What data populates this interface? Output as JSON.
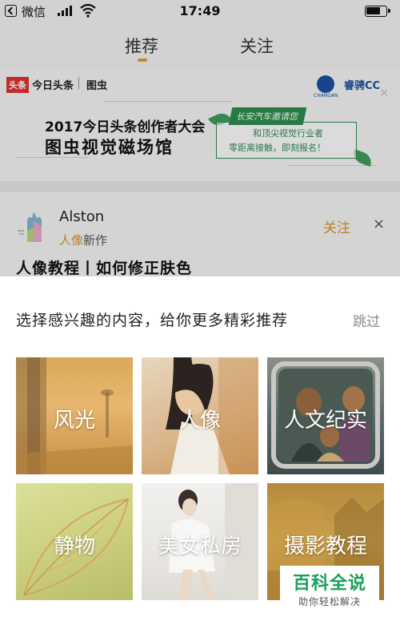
{
  "status_bar": {
    "carrier": "微信",
    "time": "17:49"
  },
  "tabs": [
    {
      "label": "推荐",
      "active": true
    },
    {
      "label": "关注",
      "active": false
    }
  ],
  "ad": {
    "logo_toutiao_badge": "头条",
    "logo_toutiao": "今日头条",
    "logo_tuchong": "图虫",
    "changan": "CHANGAN",
    "brand": "睿骋CC",
    "title_line1": "2017今日头条创作者大会",
    "title_line2": "图虫视觉磁场馆",
    "tag": "长安汽车邀请您",
    "line1": "和顶尖视觉行业者",
    "line2": "零距离接触，即刻报名！",
    "close": "×"
  },
  "card": {
    "author_name": "Alston",
    "author_tag_highlight": "人像",
    "author_tag_rest": "新作",
    "follow_label": "关注",
    "dismiss": "×",
    "title": "人像教程丨如何修正肤色"
  },
  "sheet": {
    "title": "选择感兴趣的内容，给你更多精彩推荐",
    "skip": "跳过",
    "tiles": [
      {
        "label": "风光"
      },
      {
        "label": "人像"
      },
      {
        "label": "人文纪实"
      },
      {
        "label": "静物"
      },
      {
        "label": "美女私房"
      },
      {
        "label": "摄影教程"
      }
    ]
  },
  "watermark": {
    "main": "百科全说",
    "sub": "助你轻松解决"
  },
  "colors": {
    "accent": "#d4922a",
    "tab_indicator": "#e0a020",
    "ad_green": "#2e8b4e",
    "watermark_green": "#1aa05a"
  }
}
